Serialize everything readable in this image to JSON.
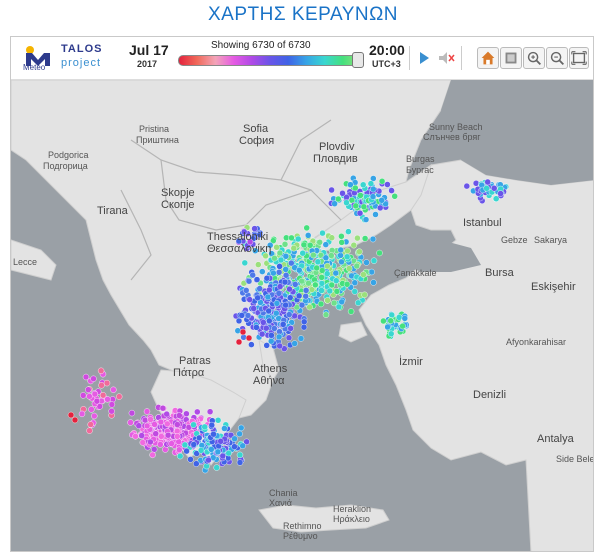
{
  "page_title": "ΧΑΡΤΗΣ ΚΕΡΑΥΝΩΝ",
  "toolbar": {
    "talos": "TALOS",
    "project": "project",
    "meteo": "Meteo",
    "date": "Jul 17",
    "year": "2017",
    "showing": "Showing 6730 of 6730",
    "time": "20:00",
    "tz": "UTC+3",
    "slider_fraction": 1.0
  },
  "controls": [
    "play-icon",
    "sound-mute-icon",
    "home-icon",
    "layers-icon",
    "zoom-in-icon",
    "zoom-out-icon",
    "fullscreen-icon"
  ],
  "colors": {
    "title": "#1a73c7",
    "sea": "#9aa0a6",
    "land": "#e3e3e3"
  },
  "map_labels": [
    {
      "name": "podgorica",
      "text": "Podgorica"
    },
    {
      "name": "podgorica-gr",
      "text": "Подгорица"
    },
    {
      "name": "pristina",
      "text": "Pristina"
    },
    {
      "name": "pristina-gr",
      "text": "Приштина"
    },
    {
      "name": "sofia",
      "text": "Sofia"
    },
    {
      "name": "sofia-gr",
      "text": "София"
    },
    {
      "name": "plovdiv",
      "text": "Plovdiv"
    },
    {
      "name": "plovdiv-gr",
      "text": "Пловдив"
    },
    {
      "name": "sunny-beach",
      "text": "Sunny Beach"
    },
    {
      "name": "sunny-beach-gr",
      "text": "Слънчев бряг"
    },
    {
      "name": "burgas",
      "text": "Burgas"
    },
    {
      "name": "burgas-gr",
      "text": "Бургас"
    },
    {
      "name": "skopje",
      "text": "Skopje"
    },
    {
      "name": "skopje-gr",
      "text": "Скопје"
    },
    {
      "name": "tirana",
      "text": "Tirana"
    },
    {
      "name": "thessaloniki",
      "text": "Thessaloniki"
    },
    {
      "name": "thessaloniki-gr",
      "text": "Θεσσαλονίκη"
    },
    {
      "name": "istanbul",
      "text": "Istanbul"
    },
    {
      "name": "gebze",
      "text": "Gebze"
    },
    {
      "name": "sakarya",
      "text": "Sakarya"
    },
    {
      "name": "lecce",
      "text": "Lecce"
    },
    {
      "name": "canakkale",
      "text": "Çanakkale"
    },
    {
      "name": "bursa",
      "text": "Bursa"
    },
    {
      "name": "eskisehir",
      "text": "Eskişehir"
    },
    {
      "name": "patras",
      "text": "Patras"
    },
    {
      "name": "patras-gr",
      "text": "Πάτρα"
    },
    {
      "name": "athens",
      "text": "Athens"
    },
    {
      "name": "athens-gr",
      "text": "Αθήνα"
    },
    {
      "name": "izmir",
      "text": "İzmir"
    },
    {
      "name": "afyonkarahisar",
      "text": "Afyonkarahisar"
    },
    {
      "name": "denizli",
      "text": "Denizli"
    },
    {
      "name": "antalya",
      "text": "Antalya"
    },
    {
      "name": "side",
      "text": "Side Belediye"
    },
    {
      "name": "chania",
      "text": "Chania"
    },
    {
      "name": "chania-gr",
      "text": "Χανιά"
    },
    {
      "name": "heraklion",
      "text": "Heraklion"
    },
    {
      "name": "heraklion-gr",
      "text": "Ηράκλειο"
    },
    {
      "name": "rethimno",
      "text": "Rethimno"
    },
    {
      "name": "rethimno-gr",
      "text": "Ρέθυμνο"
    }
  ]
}
